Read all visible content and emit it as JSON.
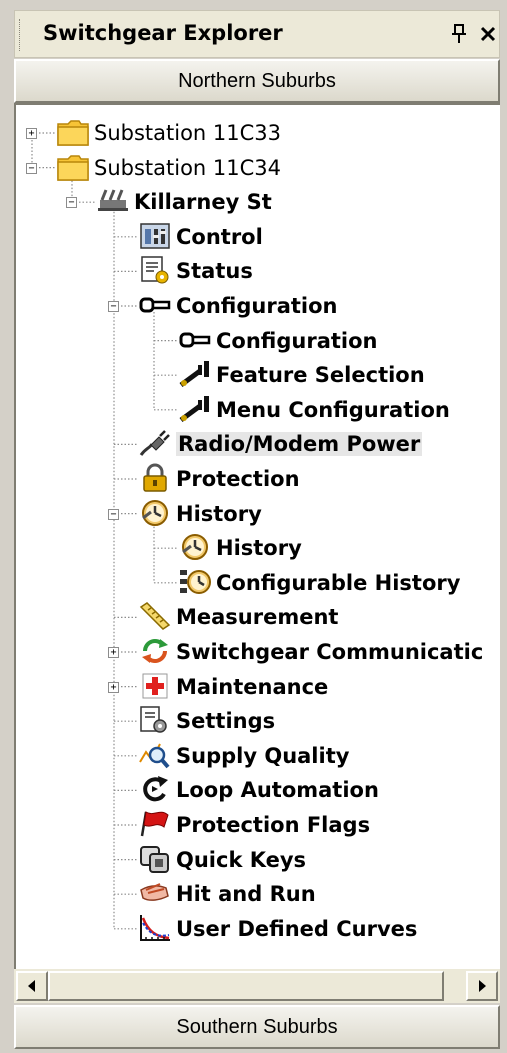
{
  "panel": {
    "title": "Switchgear Explorer",
    "pin_icon": "pin-icon",
    "close_icon": "close-icon"
  },
  "groups": {
    "top": "Northern Suburbs",
    "bottom": "Southern Suburbs"
  },
  "tree": {
    "nodes": [
      {
        "label": "Substation 11C33",
        "icon": "folder-icon",
        "depth": 0,
        "expander": "+",
        "bold": false
      },
      {
        "label": "Substation 11C34",
        "icon": "folder-icon",
        "depth": 0,
        "expander": "-",
        "bold": false
      },
      {
        "label": "Killarney St",
        "icon": "switchgear-icon",
        "depth": 1,
        "expander": "-",
        "bold": true
      },
      {
        "label": "Control",
        "icon": "control-panel-icon",
        "depth": 2,
        "expander": "",
        "bold": true
      },
      {
        "label": "Status",
        "icon": "status-doc-icon",
        "depth": 2,
        "expander": "",
        "bold": true
      },
      {
        "label": "Configuration",
        "icon": "key-icon",
        "depth": 2,
        "expander": "-",
        "bold": true
      },
      {
        "label": "Configuration",
        "icon": "key-icon",
        "depth": 3,
        "expander": "",
        "bold": true
      },
      {
        "label": "Feature Selection",
        "icon": "wrench-key-icon",
        "depth": 3,
        "expander": "",
        "bold": true
      },
      {
        "label": "Menu Configuration",
        "icon": "wrench-key-icon",
        "depth": 3,
        "expander": "",
        "bold": true
      },
      {
        "label": "Radio/Modem Power",
        "icon": "plug-icon",
        "depth": 2,
        "expander": "",
        "bold": true,
        "selected": true
      },
      {
        "label": "Protection",
        "icon": "padlock-icon",
        "depth": 2,
        "expander": "",
        "bold": true
      },
      {
        "label": "History",
        "icon": "clock-icon",
        "depth": 2,
        "expander": "-",
        "bold": true
      },
      {
        "label": "History",
        "icon": "clock-icon",
        "depth": 3,
        "expander": "",
        "bold": true
      },
      {
        "label": "Configurable History",
        "icon": "clock-list-icon",
        "depth": 3,
        "expander": "",
        "bold": true
      },
      {
        "label": "Measurement",
        "icon": "ruler-icon",
        "depth": 2,
        "expander": "",
        "bold": true
      },
      {
        "label": "Switchgear Communicatic",
        "icon": "refresh-arrows-icon",
        "depth": 2,
        "expander": "+",
        "bold": true
      },
      {
        "label": "Maintenance",
        "icon": "red-cross-icon",
        "depth": 2,
        "expander": "+",
        "bold": true
      },
      {
        "label": "Settings",
        "icon": "settings-doc-icon",
        "depth": 2,
        "expander": "",
        "bold": true
      },
      {
        "label": "Supply Quality",
        "icon": "magnifier-graph-icon",
        "depth": 2,
        "expander": "",
        "bold": true
      },
      {
        "label": "Loop Automation",
        "icon": "loop-arrow-icon",
        "depth": 2,
        "expander": "",
        "bold": true
      },
      {
        "label": "Protection Flags",
        "icon": "red-flag-icon",
        "depth": 2,
        "expander": "",
        "bold": true
      },
      {
        "label": "Quick Keys",
        "icon": "keys-icon",
        "depth": 2,
        "expander": "",
        "bold": true
      },
      {
        "label": "Hit and Run",
        "icon": "hand-icon",
        "depth": 2,
        "expander": "",
        "bold": true
      },
      {
        "label": "User Defined Curves",
        "icon": "curve-chart-icon",
        "depth": 2,
        "expander": "",
        "bold": true
      }
    ]
  },
  "scrollbar": {
    "left_icon": "scroll-left-icon",
    "right_icon": "scroll-right-icon"
  },
  "colors": {
    "folder": "#f7c436",
    "folder_edge": "#b8860b",
    "selection": "#e6e6e6",
    "panel_bg": "#d4d0c8"
  }
}
